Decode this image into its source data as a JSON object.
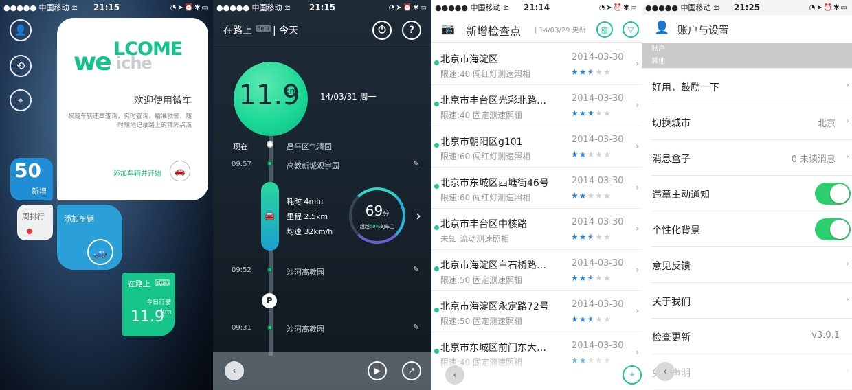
{
  "status_bars": [
    {
      "carrier": "●●●●● 中国移动 ≋",
      "time": "21:15",
      "right": "◔➤⏰✱▭"
    },
    {
      "carrier": "●●●●● 中国移动 ≋",
      "time": "21:15",
      "right": "◔➤⏰✱▭"
    },
    {
      "carrier": "●●●●● 中国移动 ≋",
      "time": "21:14",
      "right": "◔➤⏰✱▭"
    },
    {
      "carrier": "●●●●● 中国移动 ≋",
      "time": "21:25",
      "right": "◔➤⏰✱▭"
    }
  ],
  "home": {
    "logo_line1": "LCOME",
    "logo_line2": "we",
    "logo_line3": "iche",
    "welcome_title": "欢迎使用微车",
    "welcome_subtitle": "权威车辆违章查询，实时查询，精准预警，随时随地记录路上的精彩点滴",
    "add_vehicle_start": "添加车辆并开始",
    "new_count": "50",
    "new_label": "新增",
    "weekly_rank": "周排行",
    "add_vehicle": "添加车辆",
    "on_road": "在路上",
    "beta": "Beta",
    "today_drive": "今日行驶",
    "today_distance": "11.9",
    "today_unit": "km",
    "icons": [
      "person-icon",
      "refresh-icon",
      "location-pin-icon"
    ]
  },
  "trip": {
    "header_title": "在路上",
    "beta": "Beta",
    "header_period": "| 今天",
    "distance": "11.9",
    "distance_unit": "km",
    "date": "14/03/31 周一",
    "now_label": "现在",
    "points": [
      {
        "time": "",
        "place": "昌平区气清园"
      },
      {
        "time": "09:57",
        "place": "高教新城观宇园"
      },
      {
        "time": "09:52",
        "place": "沙河高教园"
      },
      {
        "time": "09:31",
        "place": "沙河高教园"
      }
    ],
    "segment": {
      "duration": "耗时 4min",
      "mileage": "里程 2.5km",
      "avg_speed": "均速 32km/h"
    },
    "score": "69",
    "score_unit": "分",
    "score_desc_prefix": "超越",
    "score_percent": "59%",
    "score_desc_suffix": "的车主",
    "parking_label": "P"
  },
  "checkpoints": {
    "title": "新增检查点",
    "updated": "| 14/03/29 更新",
    "rows": [
      {
        "place": "北京市海淀区",
        "detail": "限速:40 闯红灯测速照相",
        "date": "2014-03-30",
        "rating": 2.5
      },
      {
        "place": "北京市丰台区光彩北路…",
        "detail": "限速:40 固定测速照相",
        "date": "2014-03-30",
        "rating": 3
      },
      {
        "place": "北京市朝阳区g101",
        "detail": "限速:60 闯红灯测速照相",
        "date": "2014-03-30",
        "rating": 2
      },
      {
        "place": "北京市东城区西塘街46号",
        "detail": "限速:60 闯红灯测速照相",
        "date": "2014-03-30",
        "rating": 2
      },
      {
        "place": "北京市丰台区中核路",
        "detail": "未知 流动测速照相",
        "date": "2014-03-30",
        "rating": 2.5
      },
      {
        "place": "北京市海淀区白石桥路…",
        "detail": "限速:50 固定测速照相",
        "date": "2014-03-30",
        "rating": 2.5
      },
      {
        "place": "北京市海淀区永定路72号",
        "detail": "限速:50 固定测速照相",
        "date": "2014-03-30",
        "rating": 2.5
      },
      {
        "place": "北京市东城区前门东大…",
        "detail": "限速:40 固定测速照相",
        "date": "2014-03-30",
        "rating": 2
      }
    ]
  },
  "settings": {
    "title": "账户与设置",
    "section_account": "账户",
    "section_other": "其他",
    "rows": [
      {
        "label": "好用，鼓励一下",
        "value": "",
        "type": "link"
      },
      {
        "label": "切换城市",
        "value": "北京",
        "type": "link"
      },
      {
        "label": "消息盒子",
        "value": "0 未读消息",
        "type": "link"
      },
      {
        "label": "违章主动通知",
        "value": "",
        "type": "toggle",
        "on": true
      },
      {
        "label": "个性化背景",
        "value": "",
        "type": "toggle",
        "on": true
      },
      {
        "label": "意见反馈",
        "value": "",
        "type": "link"
      },
      {
        "label": "关于我们",
        "value": "",
        "type": "link"
      },
      {
        "label": "检查更新",
        "value": "v3.0.1",
        "type": "value"
      },
      {
        "label": "免责声明",
        "value": "",
        "type": "link"
      }
    ]
  },
  "colors": {
    "accent": "#1ac49b",
    "blue": "#2a9fd8",
    "toggle": "#2ecf6e"
  }
}
